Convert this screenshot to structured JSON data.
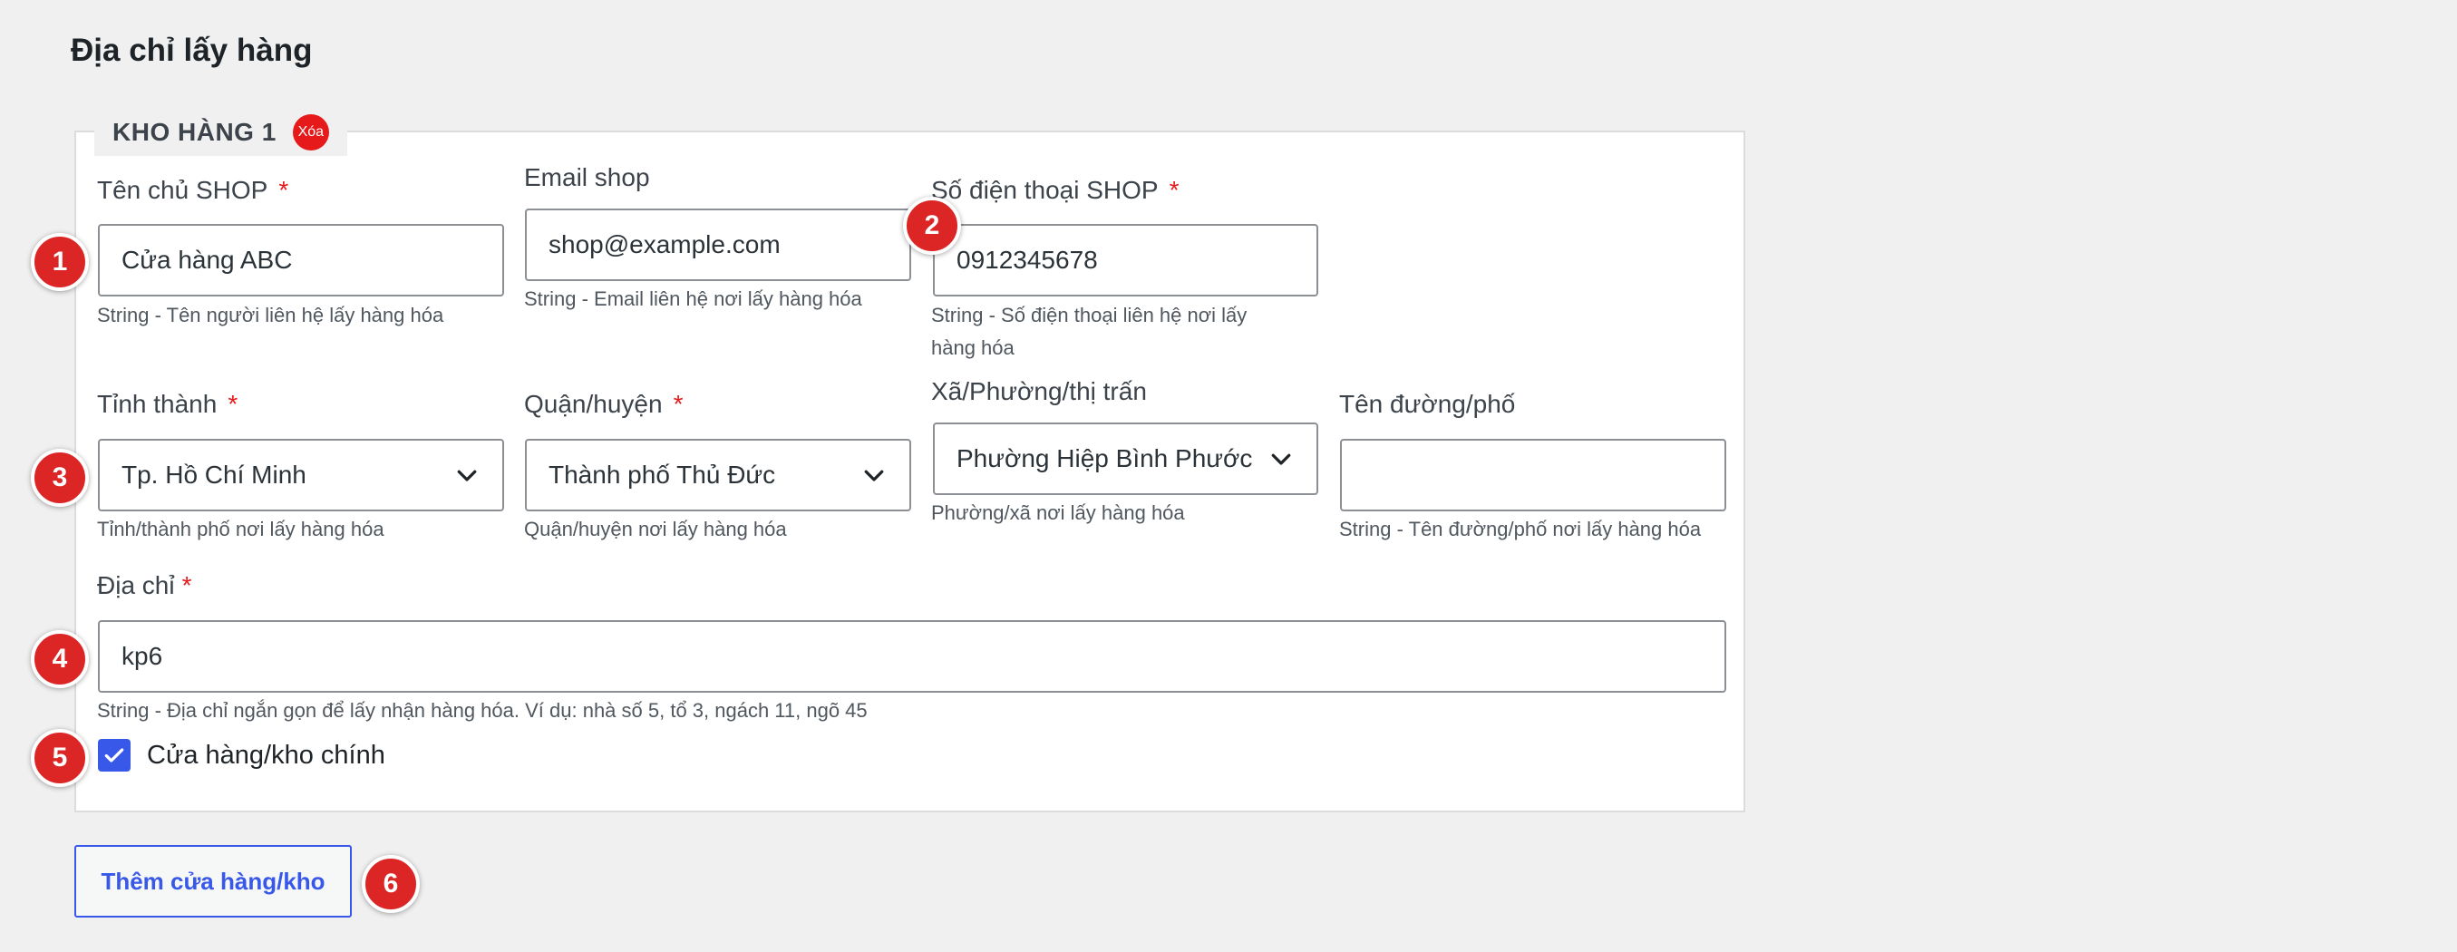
{
  "page": {
    "title": "Địa chỉ lấy hàng"
  },
  "warehouse": {
    "legend": "KHO HÀNG 1",
    "delete_label": "Xóa",
    "required_mark": "*",
    "owner": {
      "label": "Tên chủ SHOP",
      "value": "Cửa hàng ABC",
      "help": "String - Tên người liên hệ lấy hàng hóa"
    },
    "email": {
      "label": "Email shop",
      "value": "shop@example.com",
      "help": "String - Email liên hệ nơi lấy hàng hóa"
    },
    "phone": {
      "label": "Số điện thoại SHOP",
      "value": "0912345678",
      "help_line1": "String - Số điện thoại liên hệ nơi lấy",
      "help_line2": "hàng hóa"
    },
    "province": {
      "label": "Tỉnh thành",
      "value": "Tp. Hồ Chí Minh",
      "help": "Tỉnh/thành phố nơi lấy hàng hóa"
    },
    "district": {
      "label": "Quận/huyện",
      "value": "Thành phố Thủ Đức",
      "help": "Quận/huyện nơi lấy hàng hóa"
    },
    "ward": {
      "label": "Xã/Phường/thị trấn",
      "value": "Phường Hiệp Bình Phước",
      "help": "Phường/xã nơi lấy hàng hóa"
    },
    "street": {
      "label": "Tên đường/phố",
      "value": "",
      "help": "String - Tên đường/phố nơi lấy hàng hóa"
    },
    "address": {
      "label": "Địa chỉ",
      "value": "kp6",
      "help": "String - Địa chỉ ngắn gọn để lấy nhận hàng hóa. Ví dụ: nhà số 5, tổ 3, ngách 11, ngõ 45"
    },
    "main_store": {
      "label": "Cửa hàng/kho chính",
      "checked": true
    }
  },
  "add_button": {
    "label": "Thêm cửa hàng/kho"
  },
  "markers": [
    "1",
    "2",
    "3",
    "4",
    "5",
    "6"
  ],
  "colors": {
    "required": "#e61a1a",
    "accent": "#3858e9",
    "marker": "#dc2626"
  },
  "icons": {
    "select_arrow": "chevron-down-icon",
    "checkbox": "checkmark-icon"
  }
}
